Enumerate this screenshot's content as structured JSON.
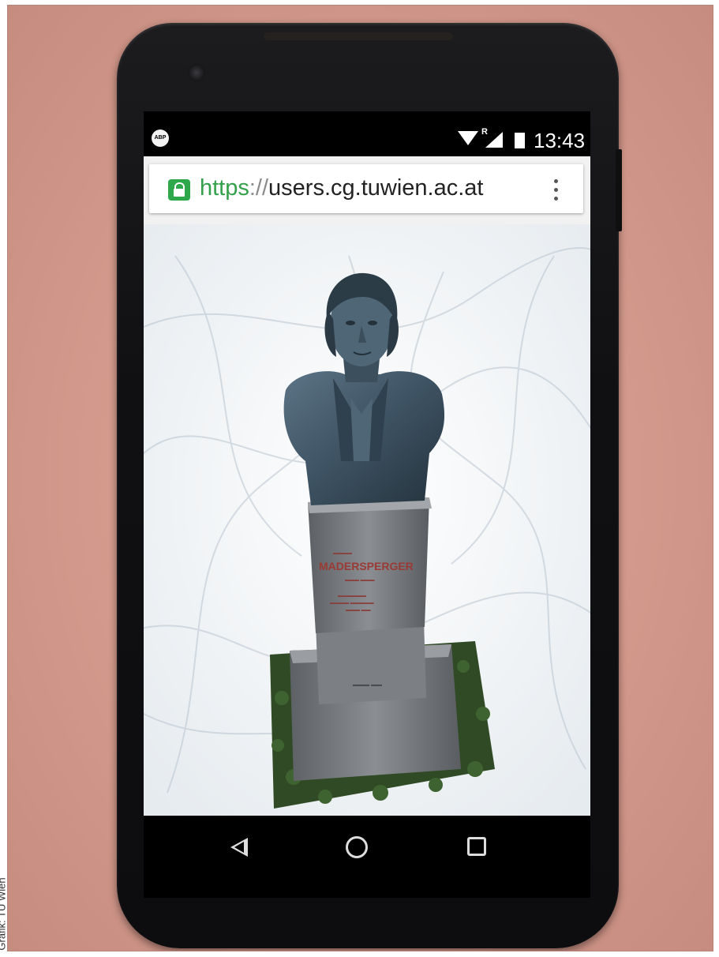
{
  "photo_credit": "Grafik: TU Wien",
  "status_bar": {
    "adblock_badge": "ABP",
    "network_roaming": "R",
    "clock": "13:43"
  },
  "browser": {
    "url_scheme": "https",
    "url_separator": "://",
    "url_host": "users.cg.tuwien.ac.at"
  },
  "content": {
    "description_subject": "3D point-cloud rendering of a bust on a stone pedestal",
    "pedestal_inscription": "MADERSPERGER"
  },
  "icons": [
    "abp-icon",
    "wifi-icon",
    "signal-icon",
    "battery-icon",
    "lock-icon",
    "menu-icon",
    "back-icon",
    "home-icon",
    "recents-icon"
  ]
}
